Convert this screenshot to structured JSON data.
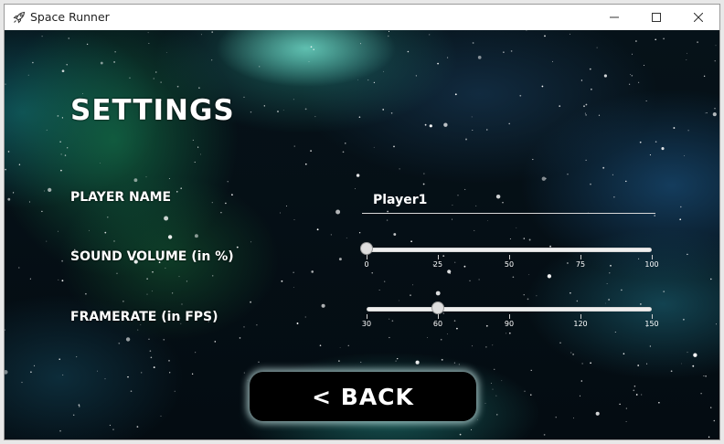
{
  "window": {
    "title": "Space Runner",
    "icon": "rocket-icon",
    "controls": [
      "minimize-icon",
      "maximize-icon",
      "close-icon"
    ]
  },
  "settings": {
    "heading": "SETTINGS",
    "player_name": {
      "label": "PLAYER NAME",
      "value": "Player1"
    },
    "sound_volume": {
      "label": "SOUND VOLUME (in %)",
      "min": 0,
      "max": 100,
      "value": 0,
      "ticks": [
        "0",
        "25",
        "50",
        "75",
        "100"
      ]
    },
    "framerate": {
      "label": "FRAMERATE (in FPS)",
      "min": 30,
      "max": 150,
      "value": 60,
      "ticks": [
        "30",
        "60",
        "90",
        "120",
        "150"
      ]
    },
    "back_label": "< BACK"
  },
  "colors": {
    "text": "#ffffff",
    "button_bg": "#000000",
    "button_glow": "#bedcdc"
  }
}
